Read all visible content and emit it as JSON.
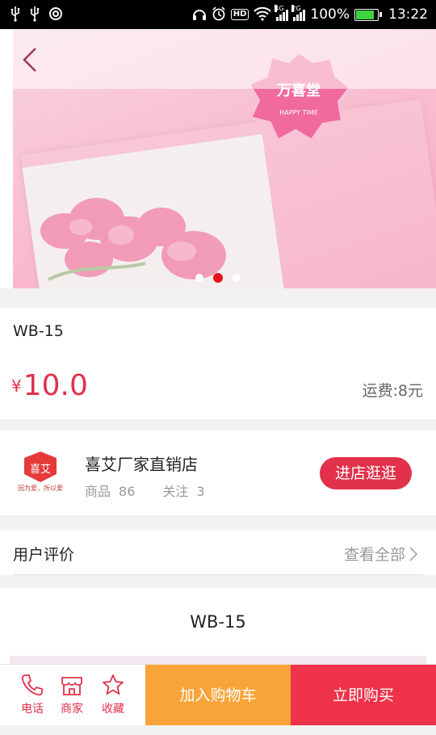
{
  "status_bar": {
    "net_4g": "4G",
    "net_2g": "2G",
    "hd": "HD",
    "battery_percent": "100%",
    "time": "13:22",
    "icons": [
      "usb-icon",
      "usb-icon",
      "sync-icon",
      "headphones-icon",
      "alarm-icon",
      "wifi-icon",
      "signal-icon",
      "battery-icon"
    ]
  },
  "hero": {
    "seal_text": "万喜堂",
    "seal_sub": "HAPPY TIME",
    "slide_count": 3,
    "active_slide": 2
  },
  "product": {
    "title": "WB-15",
    "price_symbol": "¥",
    "price": "10.0",
    "shipping": "运费:8元"
  },
  "store": {
    "logo_text": "喜艾",
    "logo_slogan": "因为爱，所以爱",
    "name": "喜艾厂家直销店",
    "goods_label": "商品",
    "goods_count": "86",
    "follow_label": "关注",
    "follow_count": "3",
    "visit_label": "进店逛逛"
  },
  "reviews": {
    "title": "用户评价",
    "view_all": "查看全部"
  },
  "detail": {
    "title": "WB-15"
  },
  "bottom_bar": {
    "phone_label": "电话",
    "store_label": "商家",
    "favorite_label": "收藏",
    "add_cart_label": "加入购物车",
    "buy_now_label": "立即购买"
  },
  "colors": {
    "accent": "#e2314b",
    "cart": "#f9a43a",
    "buy": "#ee3249"
  }
}
